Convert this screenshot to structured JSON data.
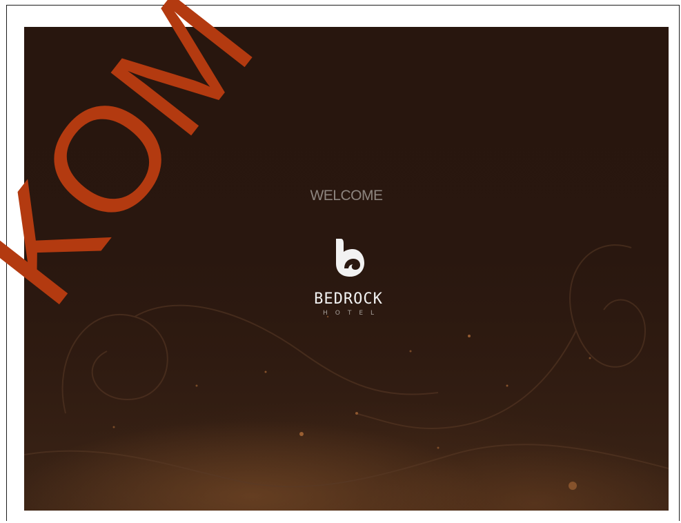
{
  "screen": {
    "welcome_text": "WELCOME",
    "logo": {
      "icon": "bedrock-b-logo-icon",
      "name": "BEDROCK",
      "sub": "HOTEL"
    }
  },
  "watermark": {
    "text": "KOM",
    "color": "#b33a10"
  },
  "colors": {
    "background_dark": "#29170f",
    "background_glow": "#7a4c28",
    "welcome_text": "#8d857f",
    "logo": "#f2f2f2"
  }
}
